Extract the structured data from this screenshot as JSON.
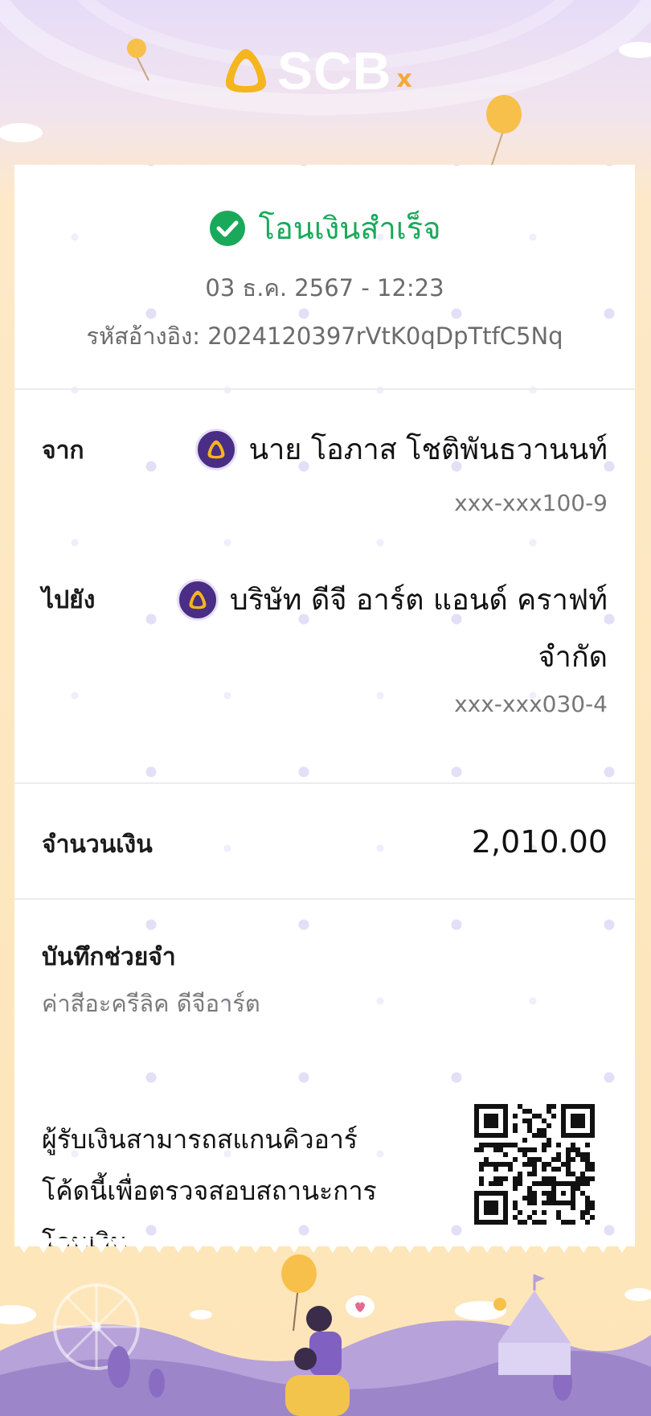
{
  "header": {
    "brand": "SCB",
    "brand_mark": "x"
  },
  "status": {
    "title": "โอนเงินสำเร็จ",
    "datetime": "03 ธ.ค. 2567  -  12:23",
    "reference": "รหัสอ้างอิง: 2024120397rVtK0qDpTtfC5Nq"
  },
  "from": {
    "label": "จาก",
    "name": "นาย โอภาส โชติพันธวานนท์",
    "account": "xxx-xxx100-9"
  },
  "to": {
    "label": "ไปยัง",
    "name_line1": "บริษัท ดีจี อาร์ต แอนด์ คราฟท์",
    "name_line2": "จำกัด",
    "account": "xxx-xxx030-4"
  },
  "amount": {
    "label": "จำนวนเงิน",
    "value": "2,010.00"
  },
  "memo": {
    "label": "บันทึกช่วยจำ",
    "value": "ค่าสีอะครีลิค  ดีจีอาร์ต"
  },
  "qr": {
    "text_line1": "ผู้รับเงินสามารถสแกนคิวอาร์",
    "text_line2": "โค้ดนี้เพื่อตรวจสอบสถานะการ",
    "text_line3": "โอนเงิน"
  },
  "colors": {
    "success": "#1aa95a",
    "brand_purple": "#4a2d84",
    "brand_gold": "#f5b51c"
  },
  "icons": [
    "check-circle-icon",
    "scb-logo-icon",
    "qr-code"
  ]
}
